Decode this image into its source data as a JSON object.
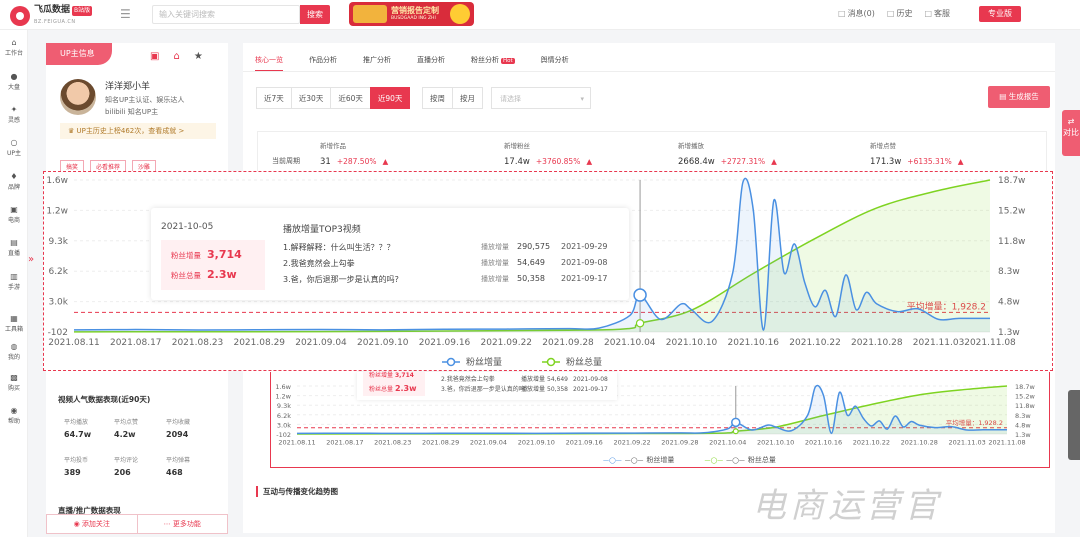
{
  "header": {
    "logo_name": "飞瓜数据",
    "logo_badge": "B站版",
    "logo_url": "BZ.FEIGUA.CN",
    "search_placeholder": "输入关键词搜索",
    "search_button": "搜索",
    "promo_title": "营销报告定制",
    "promo_subtitle": "BUSDGAAD ING ZHI",
    "links": [
      "消息(0)",
      "历史",
      "客服"
    ],
    "pro_button": "专业版"
  },
  "sidenav": [
    {
      "icon": "home-icon",
      "label": "工作台"
    },
    {
      "icon": "globe-icon",
      "label": "大盘"
    },
    {
      "icon": "bulb-icon",
      "label": "灵感"
    },
    {
      "icon": "search-icon",
      "label": "UP主"
    },
    {
      "icon": "tag-icon",
      "label": "品牌"
    },
    {
      "icon": "cart-icon",
      "label": "电商"
    },
    {
      "icon": "live-icon",
      "label": "直播"
    },
    {
      "icon": "phone-icon",
      "label": "手游"
    },
    {
      "icon": "tool-icon",
      "label": "工具箱"
    },
    {
      "icon": "user-icon",
      "label": "我的"
    },
    {
      "icon": "buy-icon",
      "label": "购买"
    },
    {
      "icon": "help-icon",
      "label": "帮助"
    }
  ],
  "profile": {
    "tag": "UP主信息",
    "name": "洋洋郑小羊",
    "line1": "知名UP主认证、娱乐达人",
    "line2": "bilibili 知名UP主",
    "history": "UP主历史上榜462次，查看成就 >",
    "tags": [
      "搞笑",
      "必看推荐",
      "沙雕"
    ],
    "stats_title": "视频人气数据表现(近90天)",
    "stats": [
      {
        "label": "平均播放",
        "value": "64.7w"
      },
      {
        "label": "平均点赞",
        "value": "4.2w"
      },
      {
        "label": "平均收藏",
        "value": "2094"
      },
      {
        "label": "平均投币",
        "value": "389"
      },
      {
        "label": "平均评论",
        "value": "206"
      },
      {
        "label": "平均弹幕",
        "value": "468"
      }
    ],
    "promo_title": "直播/推广数据表现",
    "follow_button": "添加关注",
    "more_button": "更多功能"
  },
  "main": {
    "tabs": [
      "核心一览",
      "作品分析",
      "推广分析",
      "直播分析",
      "粉丝分析",
      "舆情分析"
    ],
    "hot_badge": "Hot",
    "ranges": [
      "近7天",
      "近30天",
      "近60天",
      "近90天"
    ],
    "bytypes": [
      "按周",
      "按月"
    ],
    "date_placeholder": "请选择",
    "report_button": "生成报告",
    "period_label": "当前周期",
    "kpis": [
      {
        "label": "新增作品",
        "value": "31",
        "change": "+287.50%"
      },
      {
        "label": "新增粉丝",
        "value": "17.4w",
        "change": "+3760.85%"
      },
      {
        "label": "新增播放",
        "value": "2668.4w",
        "change": "+2727.31%"
      },
      {
        "label": "新增点赞",
        "value": "171.3w",
        "change": "+6135.31%"
      }
    ],
    "section2_title": "互动与传播变化趋势图"
  },
  "tooltip": {
    "date": "2021-10-05",
    "gain_label": "粉丝增量",
    "gain_value": "3,714",
    "total_label": "粉丝总量",
    "total_value": "2.3w",
    "title": "播放增量TOP3视频",
    "videos": [
      {
        "title": "1.解释解释：什么叫生活？？？",
        "label": "播放增量",
        "value": "290,575",
        "date": "2021-09-29"
      },
      {
        "title": "2.我爸竟然会上勾拳",
        "label": "播放增量",
        "value": "54,649",
        "date": "2021-09-08"
      },
      {
        "title": "3.爸，你后退那一步是认真的吗?",
        "label": "播放增量",
        "value": "50,358",
        "date": "2021-09-17"
      }
    ]
  },
  "small_tooltip": {
    "gain_label": "粉丝增量",
    "gain_value": "3,714",
    "total_label": "粉丝总量",
    "total_value": "2.3w",
    "videos": [
      {
        "title": "2.我爸竟然会上勾拳",
        "label": "播放增量",
        "value": "54,649",
        "date": "2021-09-08"
      },
      {
        "title": "3.爸，你后退那一步是认真的吗?",
        "label": "播放增量",
        "value": "50,358",
        "date": "2021-09-17"
      }
    ]
  },
  "chart_data": {
    "type": "line",
    "title": "",
    "x_ticks": [
      "2021.08.11",
      "2021.08.17",
      "2021.08.23",
      "2021.08.29",
      "2021.09.04",
      "2021.09.10",
      "2021.09.16",
      "2021.09.22",
      "2021.09.28",
      "2021.10.04",
      "2021.10.10",
      "2021.10.16",
      "2021.10.22",
      "2021.10.28",
      "2021.11.03",
      "2021.11.08"
    ],
    "y_left_ticks": [
      "1.6w",
      "1.2w",
      "9.3k",
      "6.2k",
      "3.0k",
      "-102"
    ],
    "y_right_ticks": [
      "18.7w",
      "15.2w",
      "11.8w",
      "8.3w",
      "4.8w",
      "1.3w"
    ],
    "y_left_range": [
      -102,
      15600
    ],
    "y_right_range": [
      13000,
      187000
    ],
    "avg_label": "平均增量：1,928.2",
    "avg_value": 1928.2,
    "series": [
      {
        "name": "粉丝增量",
        "color": "#4a90e2",
        "axis": "left",
        "x": [
          "2021.08.11",
          "2021.08.17",
          "2021.08.23",
          "2021.08.29",
          "2021.09.04",
          "2021.09.10",
          "2021.09.16",
          "2021.09.22",
          "2021.09.28",
          "2021.10.01",
          "2021.10.04",
          "2021.10.05",
          "2021.10.07",
          "2021.10.09",
          "2021.10.10",
          "2021.10.12",
          "2021.10.14",
          "2021.10.15",
          "2021.10.16",
          "2021.10.17",
          "2021.10.18",
          "2021.10.19",
          "2021.10.20",
          "2021.10.21",
          "2021.10.22",
          "2021.10.23",
          "2021.10.24",
          "2021.10.25",
          "2021.10.26",
          "2021.10.27",
          "2021.10.28",
          "2021.10.30",
          "2021.11.01",
          "2021.11.03",
          "2021.11.05",
          "2021.11.08"
        ],
        "values": [
          120,
          150,
          100,
          130,
          160,
          120,
          180,
          200,
          250,
          300,
          1600,
          3714,
          1200,
          2800,
          2200,
          1000,
          6000,
          15400,
          12500,
          100,
          13500,
          6000,
          9000,
          5000,
          2500,
          4200,
          1500,
          5800,
          2200,
          4000,
          2800,
          2000,
          2300,
          1200,
          1300,
          1300
        ]
      },
      {
        "name": "粉丝总量",
        "color": "#7ed321",
        "axis": "right",
        "x": [
          "2021.08.11",
          "2021.09.04",
          "2021.09.28",
          "2021.10.04",
          "2021.10.05",
          "2021.10.10",
          "2021.10.16",
          "2021.10.22",
          "2021.10.28",
          "2021.11.03",
          "2021.11.08"
        ],
        "values": [
          13200,
          13500,
          15000,
          17000,
          23000,
          38000,
          80000,
          120000,
          155000,
          175000,
          187000
        ]
      }
    ]
  },
  "side_tabs": {
    "contrast": "对比"
  },
  "watermark": "电商运营官"
}
